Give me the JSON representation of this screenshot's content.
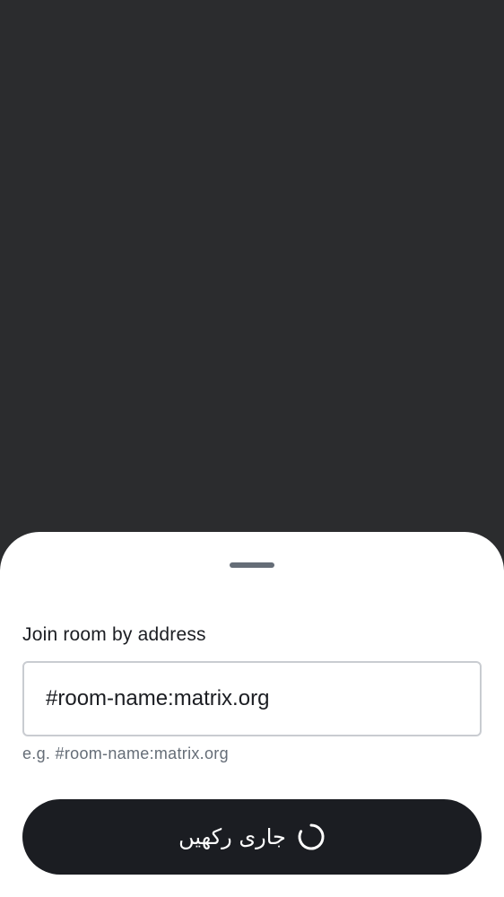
{
  "join_sheet": {
    "title": "Join room by address",
    "address_field": {
      "value": "#room-name:matrix.org",
      "placeholder": ""
    },
    "hint": "e.g. #room-name:matrix.org",
    "continue_button": {
      "label": "جاری رکھیں",
      "icon": "loading-spinner-icon"
    }
  },
  "colors": {
    "background": "#2b2c2e",
    "sheet": "#ffffff",
    "primary_text": "#1b1d22",
    "secondary_text": "#656d77",
    "field_border": "#c9ccd1",
    "button_bg": "#1b1d22",
    "button_text": "#ffffff"
  }
}
